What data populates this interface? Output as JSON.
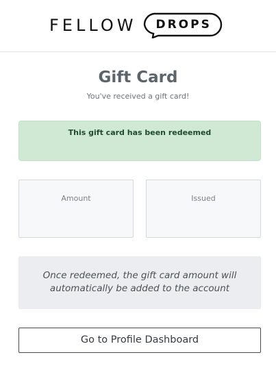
{
  "brand": {
    "left": "FELLOW",
    "right": "DROPS"
  },
  "page": {
    "title": "Gift Card",
    "subtitle": "You've received a gift card!"
  },
  "alert": {
    "text": "This gift card has been redeemed",
    "color": "#cfe9d5"
  },
  "stats": {
    "amount": {
      "label": "Amount",
      "value": ""
    },
    "issued": {
      "label": "Issued",
      "value": ""
    }
  },
  "info": {
    "text": "Once redeemed, the gift card amount will automatically be added to the account"
  },
  "actions": {
    "dashboard_label": "Go to Profile Dashboard"
  }
}
